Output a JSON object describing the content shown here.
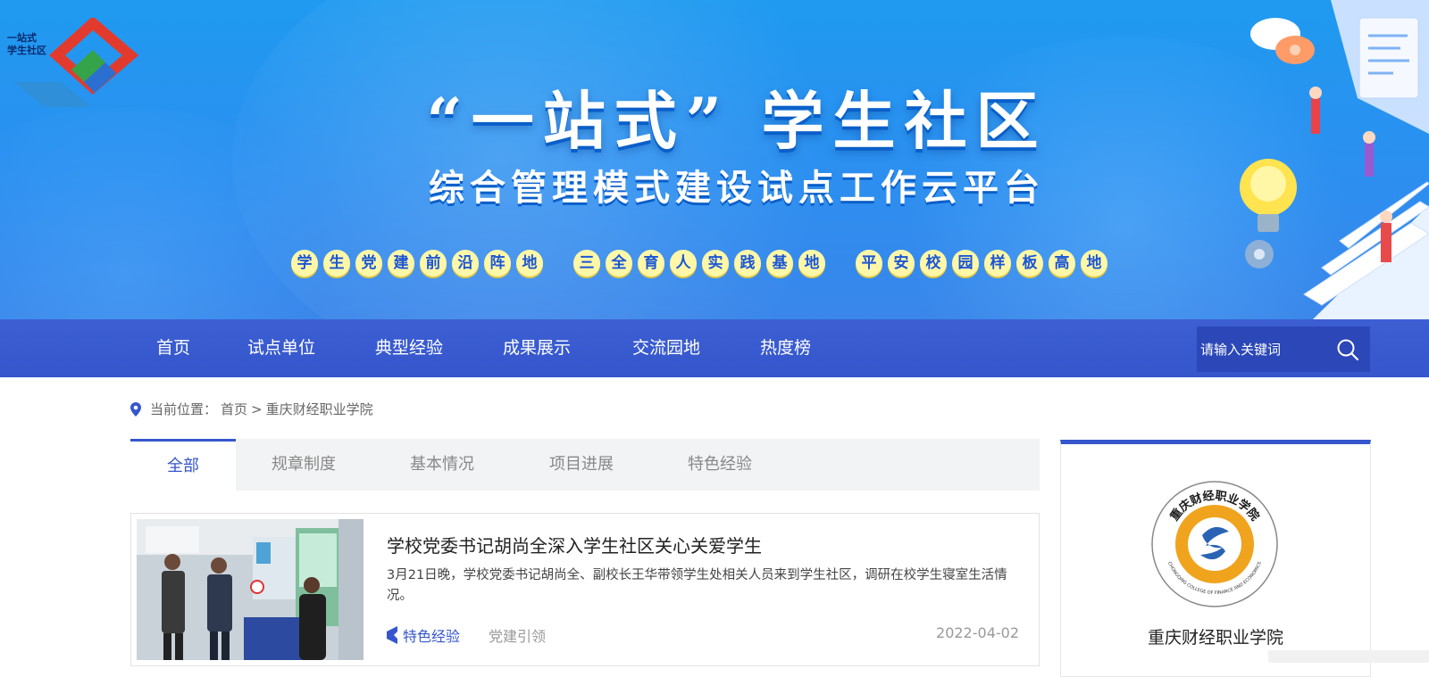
{
  "banner": {
    "logo_line1": "一站式",
    "logo_line2": "学生社区",
    "title": "“一站式” 学生社区",
    "subtitle": "综合管理模式建设试点工作云平台",
    "slogans": [
      [
        "学",
        "生",
        "党",
        "建",
        "前",
        "沿",
        "阵",
        "地"
      ],
      [
        "三",
        "全",
        "育",
        "人",
        "实",
        "践",
        "基",
        "地"
      ],
      [
        "平",
        "安",
        "校",
        "园",
        "样",
        "板",
        "高",
        "地"
      ]
    ]
  },
  "nav": {
    "items": [
      "首页",
      "试点单位",
      "典型经验",
      "成果展示",
      "交流园地",
      "热度榜"
    ],
    "search_placeholder": "请输入关键词"
  },
  "breadcrumb": {
    "label": "当前位置：",
    "home": "首页",
    "separator": ">",
    "current": "重庆财经职业学院"
  },
  "tabs": [
    "全部",
    "规章制度",
    "基本情况",
    "项目进展",
    "特色经验"
  ],
  "article": {
    "title": "学校党委书记胡尚全深入学生社区关心关爱学生",
    "summary": "3月21日晚，学校党委书记胡尚全、副校长王华带领学生处相关人员来到学生社区，调研在校学生寝室生活情况。",
    "tag": "特色经验",
    "category": "党建引领",
    "date": "2022-04-02"
  },
  "sidebar": {
    "school_name": "重庆财经职业学院",
    "seal_top_text": "重庆财经职业学院",
    "seal_side_text": "CHONGQING COLLEGE OF FINANCE AND ECONOMICS"
  },
  "colors": {
    "banner_blue": "#2c8ff0",
    "nav_blue": "#3556cc",
    "accent": "#3556cc"
  }
}
